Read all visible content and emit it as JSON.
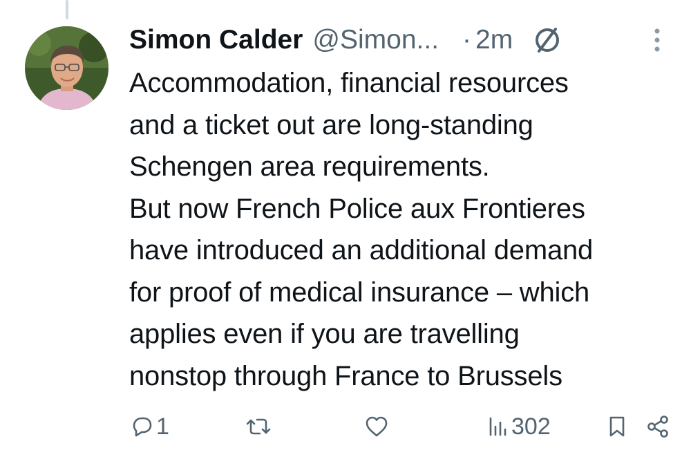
{
  "tweet": {
    "author": {
      "display_name": "Simon Calder",
      "handle": "@Simon...",
      "avatar_icon": "profile-photo"
    },
    "separator": "·",
    "time": "2m",
    "status_icon": "no-symbol-icon",
    "more_icon": "vertical-dots-icon",
    "text_lines": [
      "Accommodation, financial resources",
      "and a ticket out are long-standing",
      "Schengen area requirements.",
      "But now French Police aux Frontieres",
      "have introduced an additional demand",
      "for proof of medical insurance – which",
      "applies even if you are travelling",
      "nonstop through France to Brussels"
    ],
    "actions": {
      "reply": {
        "icon": "reply-icon",
        "count": "1"
      },
      "retweet": {
        "icon": "retweet-icon",
        "count": ""
      },
      "like": {
        "icon": "heart-icon",
        "count": ""
      },
      "views": {
        "icon": "views-icon",
        "count": "302"
      },
      "bookmark": {
        "icon": "bookmark-icon"
      },
      "share": {
        "icon": "share-icon"
      }
    }
  },
  "colors": {
    "text": "#0f1419",
    "secondary": "#536471",
    "thread_line": "#cfd9de",
    "background": "#ffffff"
  }
}
